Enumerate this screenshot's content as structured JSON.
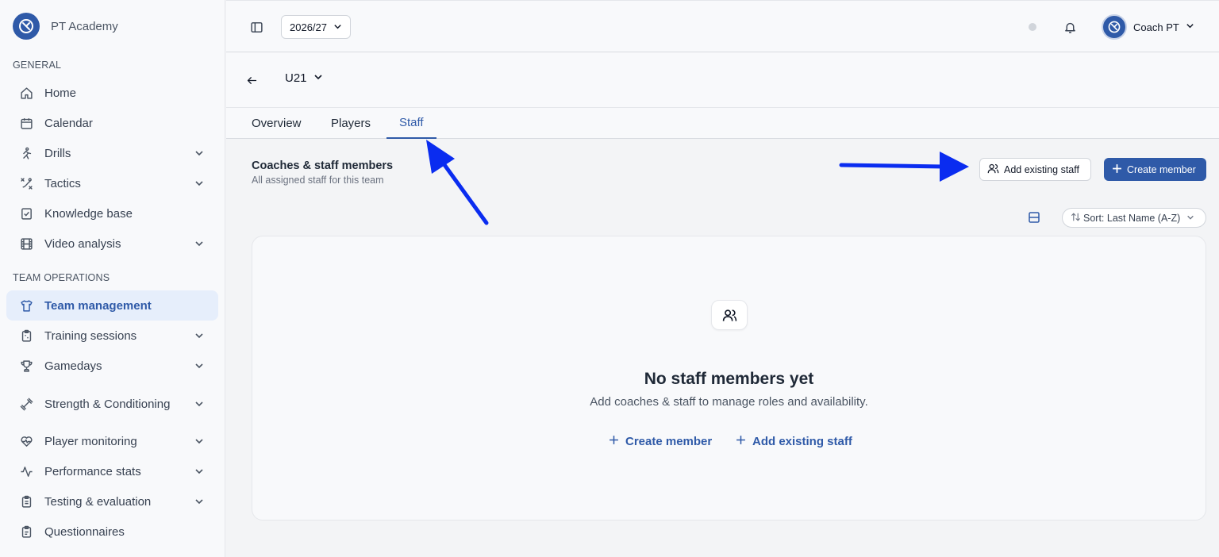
{
  "brand": {
    "name": "PT Academy"
  },
  "sidebar": {
    "general_label": "GENERAL",
    "team_ops_label": "TEAM OPERATIONS",
    "items": [
      {
        "label": "Home",
        "icon": "home-icon"
      },
      {
        "label": "Calendar",
        "icon": "calendar-icon"
      },
      {
        "label": "Drills",
        "icon": "running-icon"
      },
      {
        "label": "Tactics",
        "icon": "tactics-icon"
      },
      {
        "label": "Knowledge base",
        "icon": "knowledge-icon"
      },
      {
        "label": "Video analysis",
        "icon": "film-icon"
      },
      {
        "label": "Team management",
        "icon": "shirt-icon"
      },
      {
        "label": "Training sessions",
        "icon": "clipboard-icon"
      },
      {
        "label": "Gamedays",
        "icon": "trophy-icon"
      },
      {
        "label": "Strength & Conditioning",
        "icon": "dumbbell-icon"
      },
      {
        "label": "Player monitoring",
        "icon": "heart-pulse-icon"
      },
      {
        "label": "Performance stats",
        "icon": "activity-icon"
      },
      {
        "label": "Testing & evaluation",
        "icon": "clipboard-list-icon"
      },
      {
        "label": "Questionnaires",
        "icon": "clipboard-check-icon"
      }
    ]
  },
  "topbar": {
    "season": "2026/27",
    "user_name": "Coach PT"
  },
  "team": {
    "name": "U21"
  },
  "tabs": [
    {
      "label": "Overview"
    },
    {
      "label": "Players"
    },
    {
      "label": "Staff"
    }
  ],
  "staff": {
    "title": "Coaches & staff members",
    "subtitle": "All assigned staff for this team",
    "add_existing_label": "Add existing staff",
    "create_label": "Create member",
    "sort_label": "Sort: Last Name (A-Z)",
    "empty_title": "No staff members yet",
    "empty_subtitle": "Add coaches & staff to manage roles and availability.",
    "empty_create": "Create member",
    "empty_add_existing": "Add existing staff"
  },
  "colors": {
    "accent": "#2f5aa8",
    "annotation_arrow": "#0a2cf0"
  }
}
